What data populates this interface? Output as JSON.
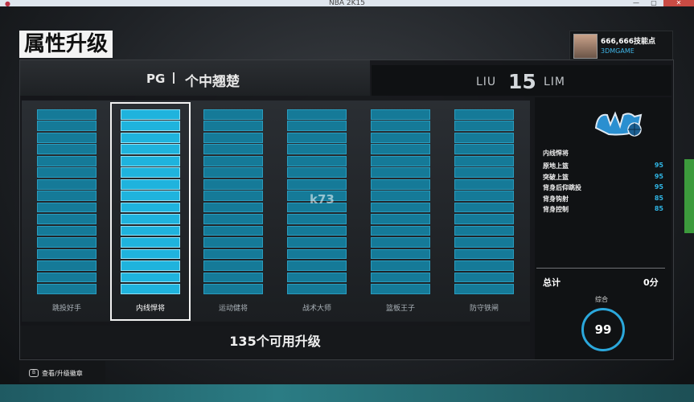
{
  "window": {
    "title": "NBA 2K15",
    "min": "—",
    "max": "▢",
    "close": "✕"
  },
  "header": {
    "title": "属性升级"
  },
  "profile": {
    "vc": "666,666技能点",
    "username": "3DMGAME"
  },
  "player": {
    "position": "PG",
    "archetype": "个中翘楚",
    "first_name": "LIU",
    "number": "15",
    "last_name": "LIM"
  },
  "categories": [
    {
      "label": "跳投好手",
      "selected": false
    },
    {
      "label": "内线悍将",
      "selected": true
    },
    {
      "label": "运动健将",
      "selected": false
    },
    {
      "label": "战术大师",
      "selected": false
    },
    {
      "label": "篮板王子",
      "selected": false
    },
    {
      "label": "防守铁闸",
      "selected": false
    }
  ],
  "upgrades_available": "135个可用升级",
  "side": {
    "team_logo": "orlando-magic-logo",
    "category_name": "内线悍将",
    "attributes": [
      {
        "name": "原地上篮",
        "value": "95"
      },
      {
        "name": "突破上篮",
        "value": "95"
      },
      {
        "name": "背身后仰跳投",
        "value": "95"
      },
      {
        "name": "背身钩射",
        "value": "85"
      },
      {
        "name": "背身控制",
        "value": "85"
      }
    ],
    "total_label": "总计",
    "total_value": "0分",
    "overall_label": "综合",
    "overall_value": "99"
  },
  "watermark": "k73",
  "hint": {
    "button": "B",
    "text": "查看/升级徽章"
  },
  "colors": {
    "accent": "#1fb3dd",
    "bar": "#157a98",
    "value": "#2fb5e5"
  }
}
